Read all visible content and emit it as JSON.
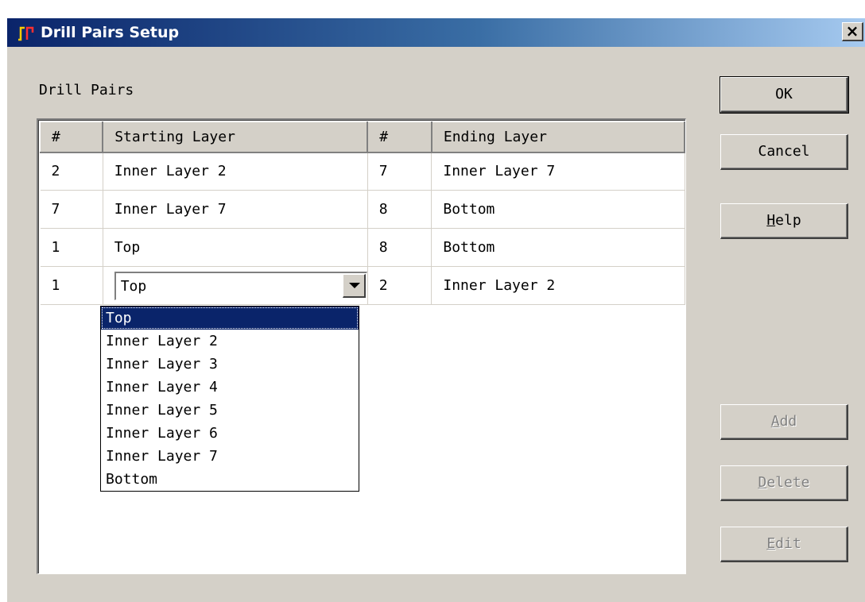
{
  "window": {
    "title": "Drill Pairs Setup",
    "close_symbol": "×"
  },
  "group_label": "Drill Pairs",
  "table": {
    "headers": [
      "#",
      "Starting Layer",
      "#",
      "Ending Layer"
    ],
    "rows": [
      {
        "start_num": "2",
        "start_layer": "Inner Layer 2",
        "end_num": "7",
        "end_layer": "Inner Layer 7"
      },
      {
        "start_num": "7",
        "start_layer": "Inner Layer 7",
        "end_num": "8",
        "end_layer": "Bottom"
      },
      {
        "start_num": "1",
        "start_layer": "Top",
        "end_num": "8",
        "end_layer": "Bottom"
      },
      {
        "start_num": "1",
        "start_layer": "Top",
        "end_num": "2",
        "end_layer": "Inner Layer 2"
      }
    ]
  },
  "dropdown": {
    "selected": "Top",
    "options": [
      "Top",
      "Inner Layer 2",
      "Inner Layer 3",
      "Inner Layer 4",
      "Inner Layer 5",
      "Inner Layer 6",
      "Inner Layer 7",
      "Bottom"
    ]
  },
  "buttons": {
    "ok": "OK",
    "cancel": "Cancel",
    "help_first": "H",
    "help_rest": "elp",
    "add_first": "A",
    "add_rest": "dd",
    "delete_first": "D",
    "delete_rest": "elete",
    "edit_first": "E",
    "edit_rest": "dit"
  },
  "colors": {
    "title_gradient_start": "#0a246a",
    "title_gradient_end": "#a6caf0",
    "dialog_face": "#d4d0c8",
    "selection": "#0a246a"
  },
  "icons": {
    "app": "drill-pairs-app-icon",
    "close": "close-icon",
    "dropdown": "chevron-down-icon"
  }
}
